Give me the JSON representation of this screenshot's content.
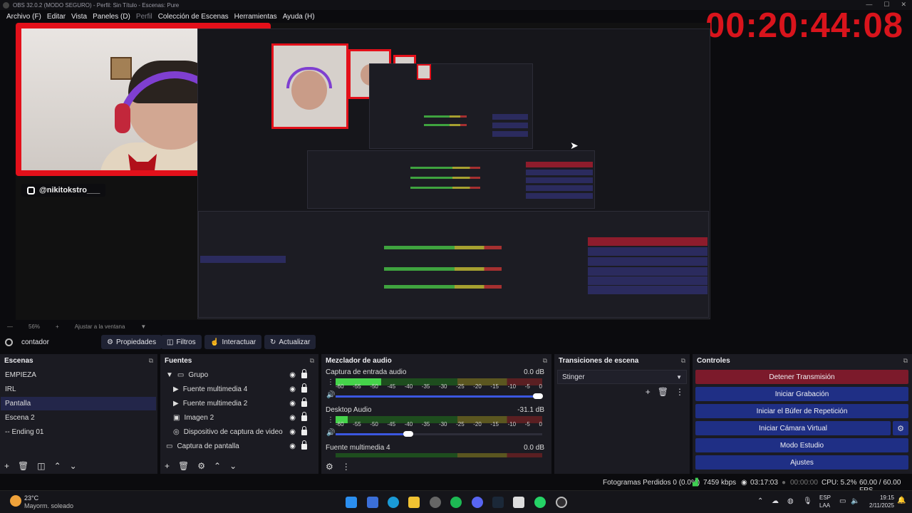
{
  "window": {
    "title": "OBS 32.0.2 (MODO SEGURO) - Perfil: Sin Título - Escenas: Pure"
  },
  "menu": [
    "Archivo (F)",
    "Editar",
    "Vista",
    "Paneles (D)",
    "Perfil",
    "Colección de Escenas",
    "Herramientas",
    "Ayuda (H)"
  ],
  "overlay": {
    "timer": "00:20:44:08",
    "instagram": "@nikitokstro___"
  },
  "preview": {
    "zoom": "56%",
    "fit_label": "Ajustar a la ventana"
  },
  "source_toolbar": {
    "selected_source": "contador",
    "buttons": [
      "Propiedades",
      "Filtros",
      "Interactuar",
      "Actualizar"
    ]
  },
  "scenes": {
    "title": "Escenas",
    "items": [
      "EMPIEZA",
      "IRL",
      "Pantalla",
      "Escena 2",
      "-- Ending 01"
    ],
    "selected": "Pantalla"
  },
  "sources": {
    "title": "Fuentes",
    "items": [
      {
        "name": "Grupo",
        "type": "group"
      },
      {
        "name": "Fuente multimedia 4",
        "type": "media"
      },
      {
        "name": "Fuente multimedia 2",
        "type": "media"
      },
      {
        "name": "Imagen 2",
        "type": "image"
      },
      {
        "name": "Dispositivo de captura de video",
        "type": "camera"
      },
      {
        "name": "Captura de pantalla",
        "type": "display"
      }
    ]
  },
  "mixer": {
    "title": "Mezclador de audio",
    "scale": [
      "-60",
      "-55",
      "-50",
      "-45",
      "-40",
      "-35",
      "-30",
      "-25",
      "-20",
      "-15",
      "-10",
      "-5",
      "0"
    ],
    "channels": [
      {
        "name": "Captura de entrada audio",
        "db": "0.0 dB",
        "level": 0.22,
        "volume": 0.98
      },
      {
        "name": "Desktop Audio",
        "db": "-31.1 dB",
        "level": 0.06,
        "volume": 0.35
      },
      {
        "name": "Fuente multimedia 4",
        "db": "0.0 dB",
        "level": 0.0,
        "volume": 1.0
      }
    ]
  },
  "transitions": {
    "title": "Transiciones de escena",
    "selected": "Stinger"
  },
  "controls": {
    "title": "Controles",
    "buttons": [
      "Detener Transmisión",
      "Iniciar Grabación",
      "Iniciar el Búfer de Repetición",
      "Iniciar Cámara Virtual",
      "Modo Estudio",
      "Ajustes"
    ]
  },
  "status": {
    "dropped": "Fotogramas Perdidos 0 (0.0%)",
    "bitrate": "7459 kbps",
    "stream_time": "03:17:03",
    "rec_time": "00:00:00",
    "cpu": "CPU: 5.2%",
    "fps": "60.00 / 60.00 FPS"
  },
  "taskbar": {
    "weather_temp": "23°C",
    "weather_desc": "Mayorm. soleado",
    "lang1": "ESP",
    "lang2": "LAA",
    "time": "19:15",
    "date": "2/11/2025"
  },
  "colors": {
    "accent_blue": "#1f2f85",
    "stop_red": "#7c1a2b",
    "timer_red": "#d8141c",
    "selected": "#23264a"
  }
}
